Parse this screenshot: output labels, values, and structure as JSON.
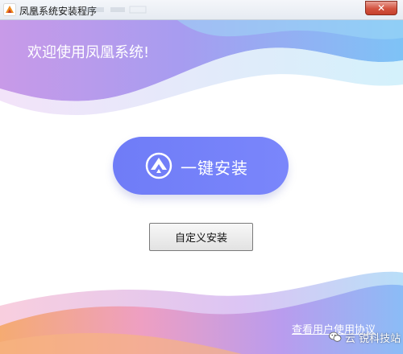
{
  "window": {
    "title": "凤凰系统安装程序",
    "close_glyph": "✕",
    "app_icon": "phoenix-app-icon"
  },
  "main": {
    "welcome_text": "欢迎使用凤凰系统!",
    "install_button_label": "一键安装",
    "install_button_icon": "phoenix-logo-icon",
    "custom_install_label": "自定义安装",
    "agreement_link": "查看用户使用协议"
  },
  "watermark": {
    "text": "云  锐科技站",
    "icon": "wechat-icon"
  },
  "colors": {
    "install_button": "#7380f9",
    "accent_purple": "#b88cec",
    "accent_blue": "#7fc6f5",
    "accent_orange": "#f4a36f",
    "close_button": "#d3533f"
  }
}
